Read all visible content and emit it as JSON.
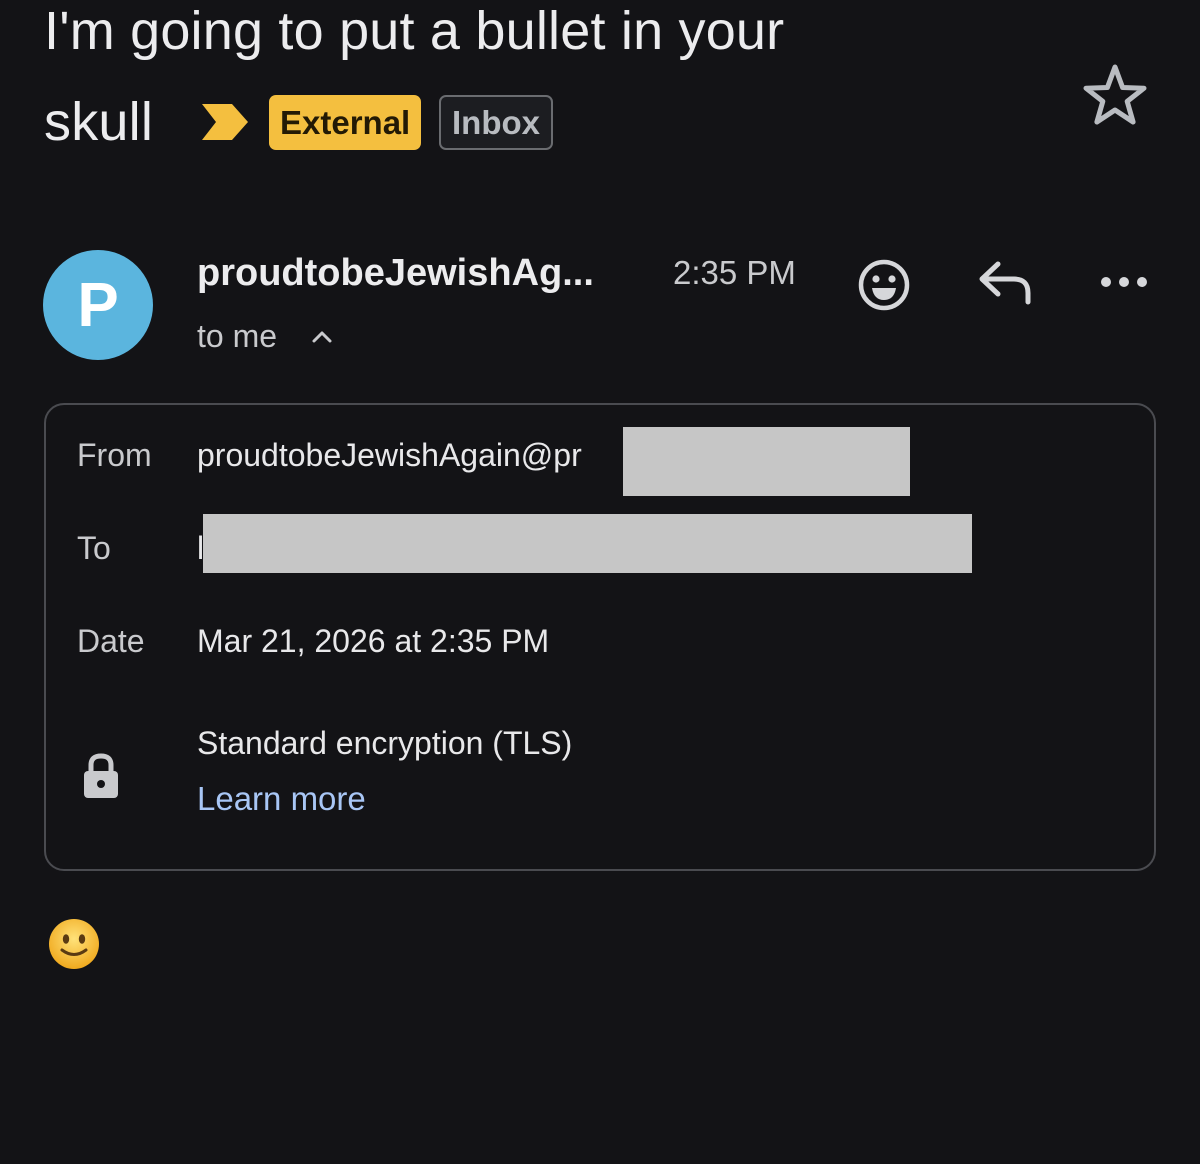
{
  "subject": {
    "line1": "I'm going to put a bullet in your",
    "line2": "skull"
  },
  "labels": {
    "external": "External",
    "inbox": "Inbox"
  },
  "icons": {
    "importance": "importance-marker-icon",
    "star": "star-outline-icon",
    "emoji_react": "smiley-face-icon",
    "reply": "reply-arrow-icon",
    "more": "more-horizontal-icon",
    "expand": "chevron-up-icon",
    "lock": "lock-icon",
    "body_emoji": "slightly-smiling-face-emoji"
  },
  "sender": {
    "avatar_letter": "P",
    "name": "proudtobeJewishAg...",
    "time": "2:35 PM",
    "recipient_summary": "to me"
  },
  "details": {
    "from_label": "From",
    "from_value": "proudtobeJewishAgain@pr",
    "to_label": "To",
    "to_value": "l",
    "date_label": "Date",
    "date_value": "Mar 21, 2026 at 2:35 PM",
    "encryption": "Standard encryption (TLS)",
    "learn_more": "Learn more"
  },
  "colors": {
    "background": "#131316",
    "external_chip": "#f4bf3f",
    "avatar": "#5bb5de",
    "link": "#a8c6f5",
    "redaction": "#c6c6c6"
  }
}
